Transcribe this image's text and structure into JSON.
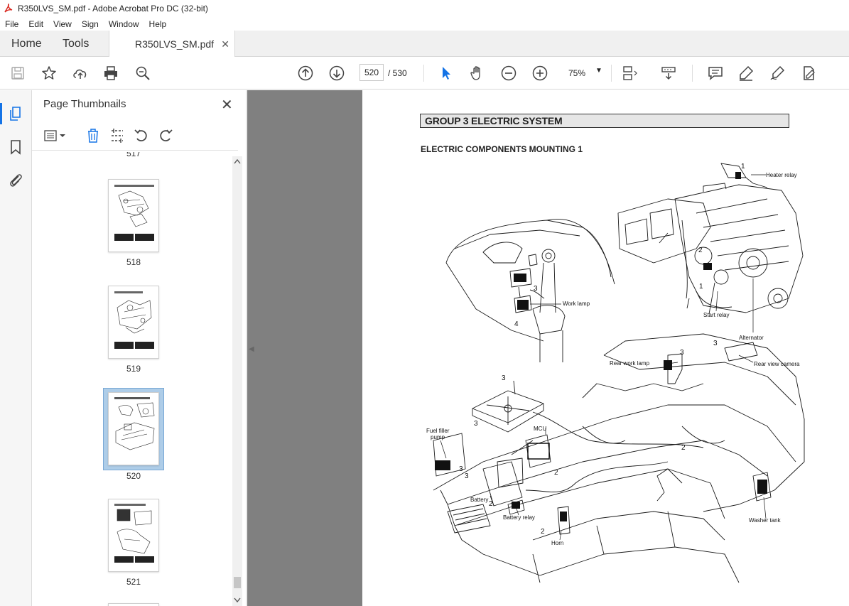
{
  "window": {
    "title": "R350LVS_SM.pdf - Adobe Acrobat Pro DC (32-bit)"
  },
  "menu": [
    "File",
    "Edit",
    "View",
    "Sign",
    "Window",
    "Help"
  ],
  "tabs": {
    "home": "Home",
    "tools": "Tools",
    "document": "R350LVS_SM.pdf"
  },
  "toolbar": {
    "current_page": "520",
    "total_pages": "/ 530",
    "zoom": "75%"
  },
  "panel": {
    "title": "Page Thumbnails",
    "partial_label": "517",
    "thumbnails": [
      {
        "label": "518"
      },
      {
        "label": "519"
      },
      {
        "label": "520",
        "selected": true
      },
      {
        "label": "521"
      }
    ]
  },
  "document": {
    "group_title": "GROUP  3  ELECTRIC SYSTEM",
    "subtitle": "ELECTRIC COMPONENTS MOUNTING 1",
    "callouts": {
      "heater_relay": "Heater relay",
      "work_lamp": "Work lamp",
      "start_relay": "Start relay",
      "alternator": "Alternator",
      "rear_work_lamp": "Rear work lamp",
      "rear_view_camera": "Rear view camera",
      "fuel_filler_pump_1": "Fuel filler",
      "fuel_filler_pump_2": "pump",
      "mcu": "MCU",
      "battery": "Battery",
      "battery_relay": "Battery relay",
      "horn": "Horn",
      "washer_tank": "Washer tank"
    },
    "numbers": {
      "one": "1",
      "two": "2",
      "three": "3",
      "four": "4"
    }
  },
  "colors": {
    "accent": "#1473e6",
    "doc_background": "#808080",
    "selected_thumb": "#aecde8",
    "pdf_red": "#d9251c"
  }
}
